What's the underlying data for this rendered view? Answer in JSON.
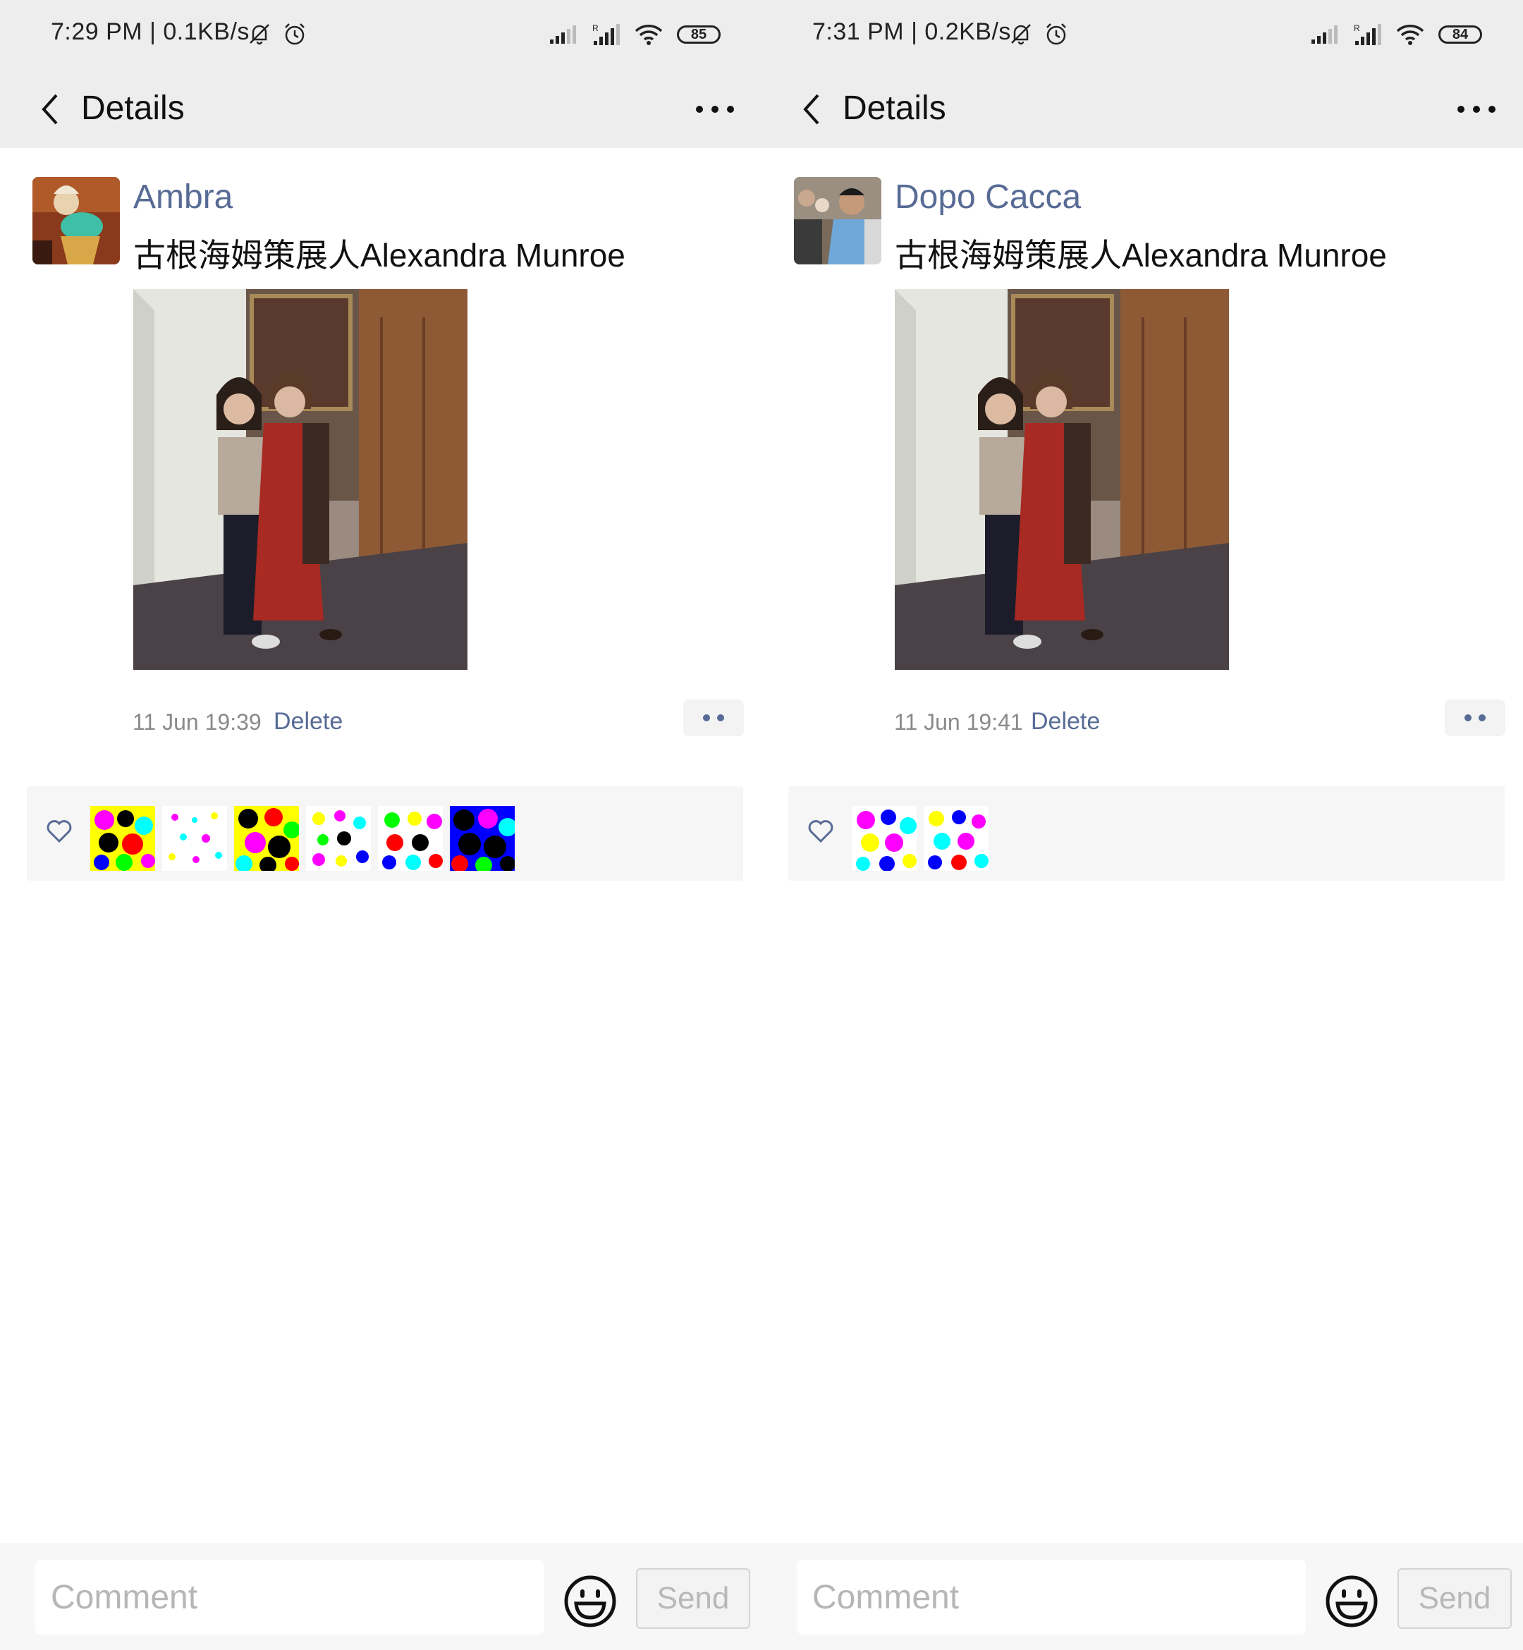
{
  "screens": [
    {
      "status_bar": {
        "time": "7:29 PM | 0.1KB/s",
        "battery": "85"
      },
      "header": {
        "title": "Details"
      },
      "post": {
        "author": "Ambra",
        "text": "古根海姆策展人Alexandra Munroe",
        "timestamp": "11 Jun 19:39",
        "delete_label": "Delete"
      },
      "likes": {
        "count": 6
      },
      "comment_bar": {
        "placeholder": "Comment",
        "send_label": "Send"
      }
    },
    {
      "status_bar": {
        "time": "7:31 PM | 0.2KB/s",
        "battery": "84"
      },
      "header": {
        "title": "Details"
      },
      "post": {
        "author": "Dopo Cacca",
        "text": "古根海姆策展人Alexandra Munroe",
        "timestamp": "11 Jun 19:41",
        "delete_label": "Delete"
      },
      "likes": {
        "count": 2
      },
      "comment_bar": {
        "placeholder": "Comment",
        "send_label": "Send"
      }
    }
  ],
  "colors": {
    "link": "#576b95",
    "header_bg": "#ededed",
    "likes_bg": "#f6f6f6",
    "timestamp": "#8a8a8a"
  },
  "icons": [
    "back-arrow-icon",
    "more-icon",
    "mute-icon",
    "alarm-icon",
    "signal-icon",
    "wifi-icon",
    "battery-icon",
    "heart-icon",
    "emoji-icon"
  ]
}
